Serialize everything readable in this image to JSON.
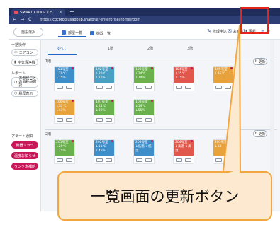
{
  "browser": {
    "tab_title": "SMART CONSOLE",
    "tab_close": "×",
    "tab_new": "+",
    "nav_back": "←",
    "nav_forward": "→",
    "nav_reload": "C",
    "url_https": "https://",
    "url_host": "cocoroplusapp.jp.sharp",
    "url_path": "/air-enterprise/home/room"
  },
  "header": {
    "facility_button": "施設選択",
    "view_tabs": [
      "部屋一覧",
      "機器一覧"
    ],
    "repair_label": "修理申込",
    "notice_label": "お知らせ",
    "refresh_label": "更新",
    "menu_label": "設"
  },
  "sidebar": {
    "bulk_heading": "一括操作",
    "bulk_items": [
      "エアコン",
      "空気清浄機"
    ],
    "report_heading": "レポート",
    "report_items": [
      "お部屋ごとの消耗品確認",
      "履歴表示"
    ],
    "alert_heading": "アラート通知",
    "alert_items": [
      "機器エラー",
      "温度お知らせ",
      "タンク水補給"
    ]
  },
  "floor_tabs": [
    "すべて",
    "1階",
    "2階",
    "3階"
  ],
  "floors": [
    {
      "label": "1階",
      "refresh": "更新",
      "rooms": [
        {
          "name": "101号室",
          "status": "↓20℃ ↓25%",
          "color": "#3e8ec9"
        },
        {
          "name": "102号室",
          "status": "↓20℃ ↓75%",
          "color": "#4aa0c4"
        },
        {
          "name": "103号室",
          "status": "↓24℃ ↓74%",
          "color": "#6ab04c"
        },
        {
          "name": "104号室",
          "status": "↓35℃ ↓75%",
          "color": "#e2574c"
        },
        {
          "name": "105号室",
          "status": "↓35℃",
          "color": "#e8a23c"
        }
      ],
      "rooms_row2": [
        {
          "name": "106号室",
          "status": "↓33℃ ↓43%",
          "color": "#e8a23c"
        },
        {
          "name": "107号室",
          "status": "↓24℃ ↓39%",
          "color": "#6ab04c"
        },
        {
          "name": "108号室",
          "status": "↓19℃ ↓55%",
          "color": "#6ab04c"
        }
      ]
    },
    {
      "label": "2階",
      "refresh": "更新",
      "rooms": [
        {
          "name": "201号室",
          "status": "↓20℃ ↓75%",
          "color": "#6ab04c"
        },
        {
          "name": "202号室",
          "status": "↓11℃ ↓45%",
          "color": "#3e8ec9"
        },
        {
          "name": "203号室",
          "status": "↓低温 ↓低湿",
          "color": "#3e8ec9"
        },
        {
          "name": "204号室",
          "status": "↓高温 ↓高湿",
          "color": "#e2574c"
        },
        {
          "name": "205号室",
          "status": "↓18",
          "color": "#e8a23c"
        }
      ]
    }
  ],
  "annotation": {
    "callout_text": "一覧画面の更新ボタン",
    "highlight_color": "#e8231c",
    "callout_border": "#f2a640",
    "callout_fill": "#fde9cf"
  }
}
